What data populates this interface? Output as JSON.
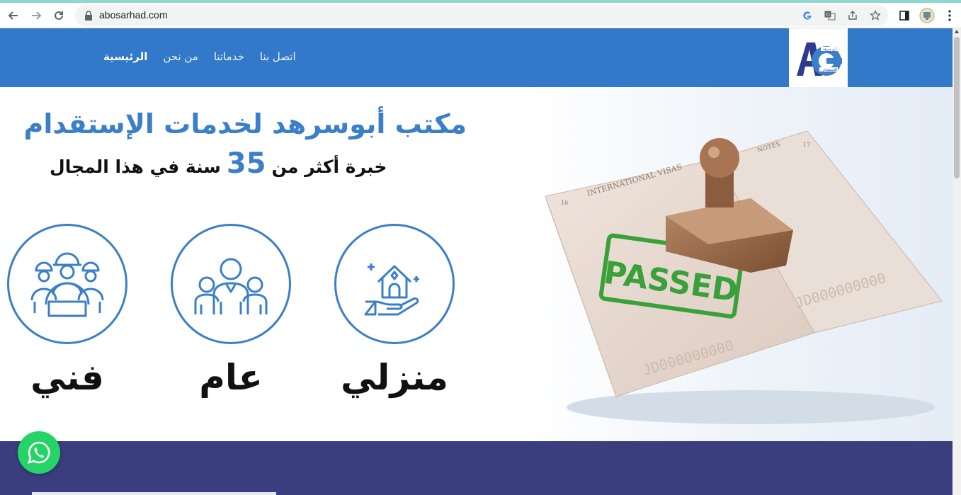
{
  "browser": {
    "url": "abosarhad.com",
    "nav_icons": [
      "back-arrow-icon",
      "forward-arrow-icon",
      "reload-icon"
    ],
    "omnibox_icons": [
      "google-icon",
      "translate-icon",
      "share-icon",
      "bookmark-star-icon"
    ],
    "toolbar_icons": [
      "side-panel-icon",
      "profile-avatar-icon",
      "kebab-menu-icon"
    ]
  },
  "header": {
    "bg_color": "#3379c9",
    "logo_text_top": "أبو سرهد",
    "logo_text_bottom": "للاستقدام",
    "menu": [
      {
        "label": "الرئيسية",
        "active": true
      },
      {
        "label": "من نحن",
        "active": false
      },
      {
        "label": "خدماتنا",
        "active": false
      },
      {
        "label": "اتصل بنا",
        "active": false
      }
    ]
  },
  "hero": {
    "title": "مكتب أبوسرهد لخدمات الإستقدام",
    "subtitle_before": "خبرة أكثر من",
    "subtitle_number": "35",
    "subtitle_after": "سنة في هذا المجال",
    "accent_color": "#3a7fc8",
    "services": [
      {
        "label": "منزلي",
        "icon": "home-in-hand-icon"
      },
      {
        "label": "عام",
        "icon": "family-group-icon"
      },
      {
        "label": "فني",
        "icon": "workers-helmet-icon"
      }
    ],
    "passport": {
      "stamp_text": "PASSED",
      "page_heading": "INTERNATIONAL VISAS",
      "notes_heading": "NOTES",
      "page_left_num": "16",
      "page_right_num": "17",
      "serial": "JD000000000"
    }
  },
  "band": {
    "color": "#3a3d7e"
  },
  "whatsapp": {
    "icon": "whatsapp-icon"
  }
}
